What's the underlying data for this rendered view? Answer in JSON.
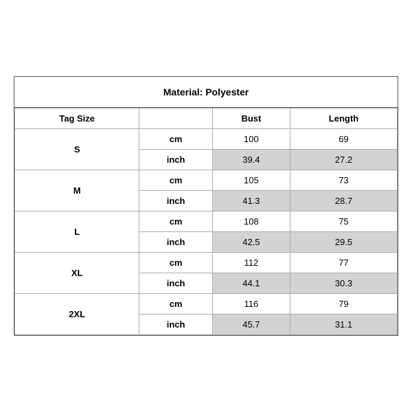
{
  "title": "Material: Polyester",
  "headers": {
    "tag_size": "Tag Size",
    "bust": "Bust",
    "length": "Length"
  },
  "sizes": [
    {
      "label": "S",
      "cm": {
        "bust": "100",
        "length": "69"
      },
      "inch": {
        "bust": "39.4",
        "length": "27.2"
      }
    },
    {
      "label": "M",
      "cm": {
        "bust": "105",
        "length": "73"
      },
      "inch": {
        "bust": "41.3",
        "length": "28.7"
      }
    },
    {
      "label": "L",
      "cm": {
        "bust": "108",
        "length": "75"
      },
      "inch": {
        "bust": "42.5",
        "length": "29.5"
      }
    },
    {
      "label": "XL",
      "cm": {
        "bust": "112",
        "length": "77"
      },
      "inch": {
        "bust": "44.1",
        "length": "30.3"
      }
    },
    {
      "label": "2XL",
      "cm": {
        "bust": "116",
        "length": "79"
      },
      "inch": {
        "bust": "45.7",
        "length": "31.1"
      }
    }
  ],
  "units": {
    "cm": "cm",
    "inch": "inch"
  }
}
